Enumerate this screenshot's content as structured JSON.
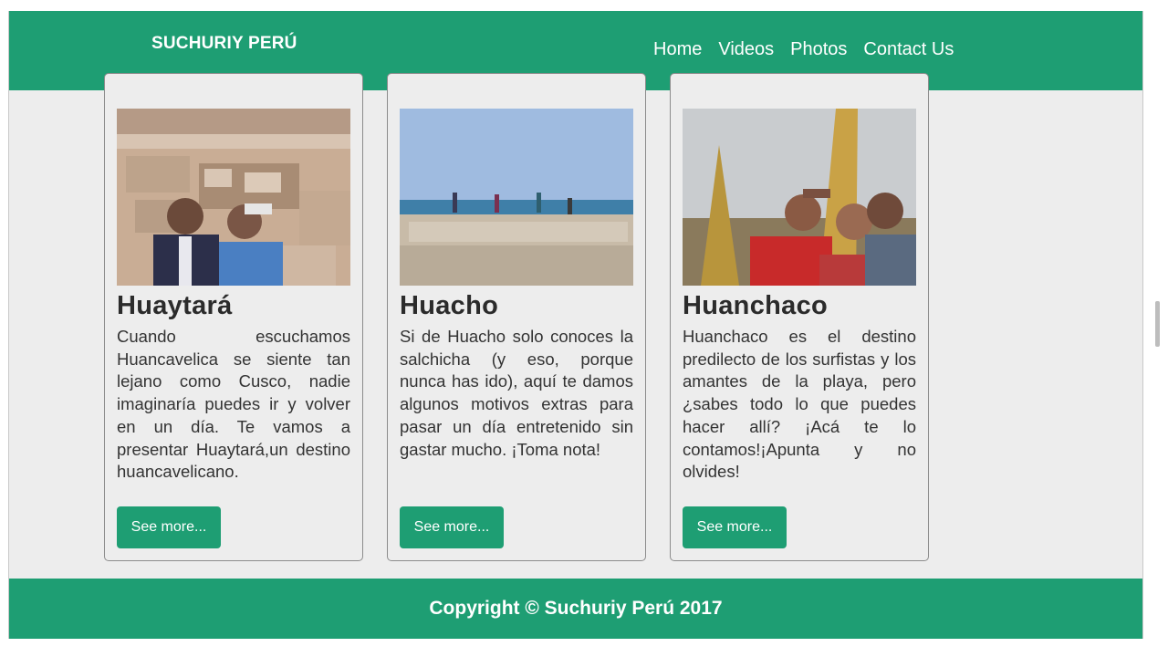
{
  "header": {
    "brand": "SUCHURIY PERÚ",
    "nav": [
      "Home",
      "Videos",
      "Photos",
      "Contact Us"
    ]
  },
  "cards": [
    {
      "title": "Huaytará",
      "text": "Cuando escuchamos Huancavelica se siente tan lejano como Cusco, nadie imaginaría puedes ir y volver en un día. Te vamos a presentar Huaytará,un destino huancavelicano.",
      "button": "See more..."
    },
    {
      "title": "Huacho",
      "text": "Si de Huacho solo conoces la salchicha (y eso, porque nunca has ido), aquí te damos algunos motivos extras para pasar un día entretenido sin gastar mucho. ¡Toma nota!",
      "button": "See more..."
    },
    {
      "title": "Huanchaco",
      "text": "Huanchaco es el destino predilecto de los surfistas y los amantes de la playa, pero ¿sabes todo lo que puedes hacer allí? ¡Acá te lo contamos!¡Apunta y no olvides!",
      "button": "See more..."
    }
  ],
  "footer": {
    "copyright": "Copyright © Suchuriy Perú 2017"
  },
  "colors": {
    "accent": "#1e9e73",
    "background": "#ededed"
  }
}
